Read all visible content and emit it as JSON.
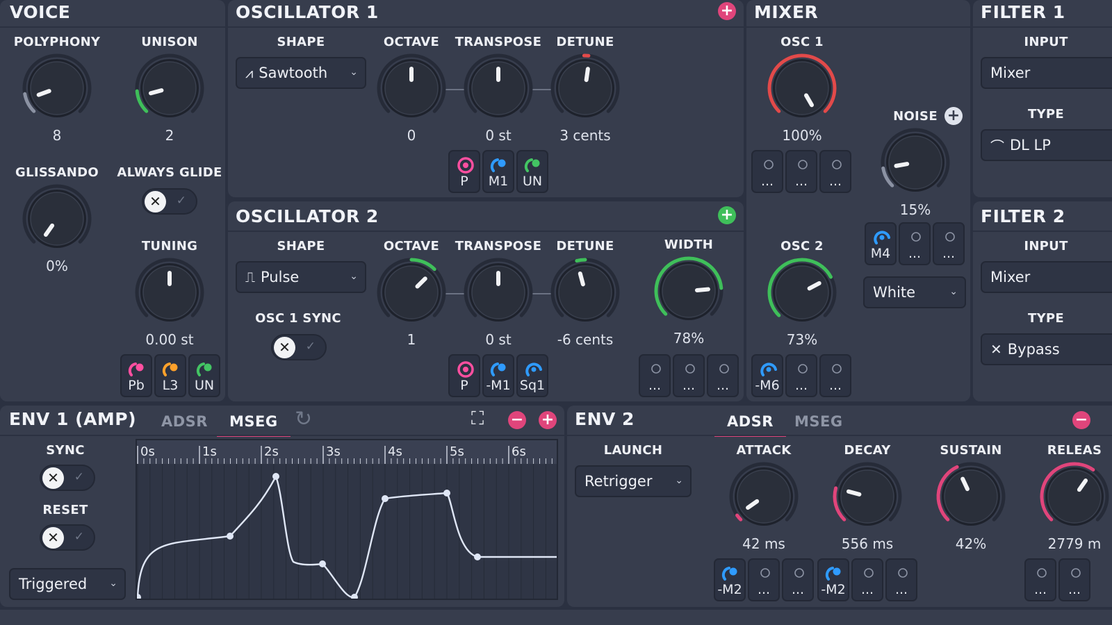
{
  "voice": {
    "title": "VOICE",
    "polyphony": {
      "label": "POLYPHONY",
      "value": "8",
      "level": 0.5
    },
    "unison": {
      "label": "UNISON",
      "value": "2",
      "level": 0.12
    },
    "glissando": {
      "label": "GLISSANDO",
      "value": "0%",
      "level": 0.0
    },
    "always_glide": {
      "label": "ALWAYS GLIDE"
    },
    "tuning": {
      "label": "TUNING",
      "value": "0.00 st",
      "level": 0.5
    },
    "mods": [
      "Pb",
      "L3",
      "UN"
    ]
  },
  "osc1": {
    "title": "OSCILLATOR 1",
    "shape": {
      "label": "SHAPE",
      "value": "Sawtooth"
    },
    "octave": {
      "label": "OCTAVE",
      "value": "0"
    },
    "transpose": {
      "label": "TRANSPOSE",
      "value": "0 st"
    },
    "detune": {
      "label": "DETUNE",
      "value": "3 cents"
    },
    "mods": [
      "P",
      "M1",
      "UN"
    ]
  },
  "osc2": {
    "title": "OSCILLATOR 2",
    "shape": {
      "label": "SHAPE",
      "value": "Pulse"
    },
    "sync": {
      "label": "OSC 1 SYNC"
    },
    "octave": {
      "label": "OCTAVE",
      "value": "1"
    },
    "transpose": {
      "label": "TRANSPOSE",
      "value": "0 st"
    },
    "detune": {
      "label": "DETUNE",
      "value": "-6 cents"
    },
    "width": {
      "label": "WIDTH",
      "value": "78%"
    },
    "mods": [
      "P",
      "-M1",
      "Sq1"
    ],
    "slots": [
      "...",
      "...",
      "..."
    ]
  },
  "mixer": {
    "title": "MIXER",
    "osc1": {
      "label": "OSC 1",
      "value": "100%"
    },
    "osc2": {
      "label": "OSC 2",
      "value": "73%"
    },
    "noise": {
      "label": "NOISE",
      "value": "15%",
      "type": "White"
    },
    "osc1_slots": [
      "...",
      "...",
      "..."
    ],
    "noise_mods": [
      "M4",
      "...",
      "..."
    ],
    "osc2_mods": [
      "-M6",
      "...",
      "..."
    ]
  },
  "filter1": {
    "title": "FILTER 1",
    "input_label": "INPUT",
    "input": "Mixer",
    "type_label": "TYPE",
    "type": "DL LP"
  },
  "filter2": {
    "title": "FILTER 2",
    "input_label": "INPUT",
    "input": "Mixer",
    "type_label": "TYPE",
    "type": "Bypass"
  },
  "env1": {
    "title": "ENV 1 (AMP)",
    "tabs": [
      "ADSR",
      "MSEG"
    ],
    "active_tab": "MSEG",
    "sync_label": "SYNC",
    "reset_label": "RESET",
    "mode": "Triggered",
    "timeline": [
      "0s",
      "1s",
      "2s",
      "3s",
      "4s",
      "5s",
      "6s"
    ]
  },
  "env2": {
    "title": "ENV 2",
    "tabs": [
      "ADSR",
      "MSEG"
    ],
    "active_tab": "ADSR",
    "launch": {
      "label": "LAUNCH",
      "value": "Retrigger"
    },
    "attack": {
      "label": "ATTACK",
      "value": "42 ms"
    },
    "decay": {
      "label": "DECAY",
      "value": "556 ms"
    },
    "sustain": {
      "label": "SUSTAIN",
      "value": "42%"
    },
    "release": {
      "label": "RELEAS",
      "value": "2779 m"
    },
    "mods": [
      "-M2",
      "...",
      "...",
      "-M2",
      "...",
      "...",
      "...",
      "..."
    ]
  },
  "colors": {
    "accent_pink": "#e0457b",
    "accent_green": "#3fbf5a",
    "accent_red": "#e24a4a",
    "mod_blue": "#2f9bff",
    "mod_pink": "#ff4fa0",
    "mod_orange": "#ffa12b",
    "mod_green": "#43c463"
  }
}
